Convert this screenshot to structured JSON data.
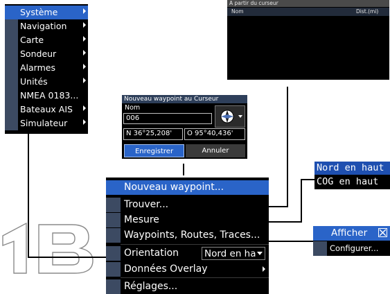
{
  "left_menu": {
    "items": [
      {
        "label": "Système",
        "submenu": true,
        "selected": true
      },
      {
        "label": "Navigation",
        "submenu": true
      },
      {
        "label": "Carte",
        "submenu": true
      },
      {
        "label": "Sondeur",
        "submenu": true
      },
      {
        "label": "Alarmes",
        "submenu": true
      },
      {
        "label": "Unités",
        "submenu": true
      },
      {
        "label": "NMEA 0183...",
        "submenu": false
      },
      {
        "label": "Bateaux AIS",
        "submenu": true
      },
      {
        "label": "Simulateur",
        "submenu": true
      }
    ]
  },
  "cursor_panel": {
    "title": "A partir du curseur",
    "col_name": "Nom",
    "col_dist": "Dist.(mi)"
  },
  "waypoint_dialog": {
    "title": "Nouveau waypoint au Curseur",
    "name_label": "Nom",
    "name_value": "006",
    "lat": "N  36°25,208'",
    "lon": "O  95°40,436'",
    "save_label": "Enregistrer",
    "cancel_label": "Annuler"
  },
  "main_menu": {
    "items": [
      {
        "label": "Nouveau waypoint...",
        "selected": true
      },
      {
        "label": "Trouver..."
      },
      {
        "label": "Mesure"
      },
      {
        "label": "Waypoints, Routes, Traces..."
      },
      {
        "label": "Orientation"
      },
      {
        "label": "Données Overlay"
      },
      {
        "label": "Réglages..."
      }
    ],
    "orientation_value": "Nord en ha"
  },
  "orientation_options": {
    "items": [
      "Nord en haut",
      "COG en haut"
    ]
  },
  "overlay_submenu": {
    "show_label": "Afficher",
    "configure_label": "Configurer..."
  },
  "colors": {
    "highlight": "#2a64c8",
    "gutter": "#3c4a62",
    "background": "#000000"
  }
}
